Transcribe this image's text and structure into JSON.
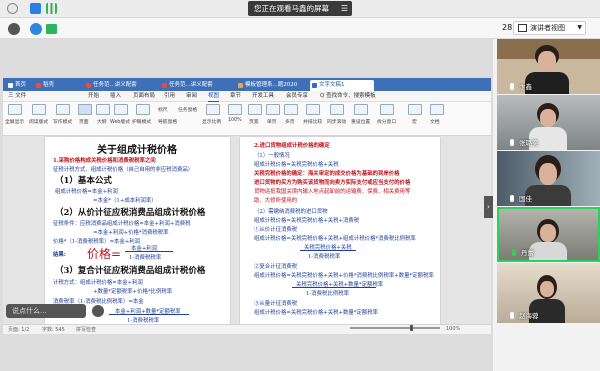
{
  "top_bar": {
    "banner": "您正在观看马鑫的屏幕"
  },
  "meeting_bar": {
    "timer": "28:11",
    "presenter_view": "演讲者视图"
  },
  "wps": {
    "tabs": [
      {
        "label": "首页"
      },
      {
        "label": "稻壳"
      },
      {
        "label": "任务范...讲义配套"
      },
      {
        "label": "任务范...讲义配套"
      },
      {
        "label": "模板管理系...题2020"
      },
      {
        "label": "文字文稿1"
      }
    ],
    "menus": [
      "三 文件",
      "开始",
      "插入",
      "页面布局",
      "引用",
      "审阅",
      "视图",
      "章节",
      "开发工具",
      "会员专享",
      "Q 查找命令、搜索模板"
    ],
    "ribbon": [
      "全屏显示",
      "阅读版式",
      "写作模式",
      "页面",
      "大纲",
      "Web版式",
      "护眼模式",
      "标尺",
      "任务窗格",
      "导航窗格",
      "显示比例",
      "100%",
      "页宽",
      "单页",
      "多页",
      "并排比较",
      "同步滚动",
      "重设位置",
      "拆分窗口",
      "宏",
      "文档"
    ],
    "status": {
      "page": "页面: 1/2",
      "words": "字数: 545",
      "check": "拼写检查",
      "zoom": "100%"
    }
  },
  "doc_left": {
    "title": "关于组成计税价格",
    "line1": "1.采购价格构成关税价格和消费税税率之间",
    "line2": "征税计税方式、组成计税价格（自己自用的非应税消费品）",
    "sec1": "（1）基本公式",
    "f1": "组成计税价格=本金+利润",
    "f2": "=本金*（1+成本利润率）",
    "sec2": "（2）从价计征应税消费品组成计税价格",
    "note2": "征税条件：应税消费品组成计税价格=本金+利润+消费税",
    "f3": "=本金+利润+价格*消费税税率",
    "f4": "价格*（1-消费税税率）=本金+利润",
    "calc": "结果:",
    "price_big": "价格=",
    "num": "本金+利润",
    "den": "1-消费税税率",
    "sec3": "（3）复合计征应税消费品组成计税价格",
    "note3": "计税方式：组成计税价格=本金+利润",
    "f5": "+数量*定额税率+价格*比例税率",
    "f6": "消费税率（1-消费税比例税率）=本金",
    "num2": "本金+利润+数量*定额税率",
    "den2": "1-消费税税率"
  },
  "doc_right": {
    "h1": "2.进口货物组成计税价格的确定",
    "sec1": "（1）一般情况",
    "l1": "组成计税价格=关税完税价格+关税",
    "l2": "关税完税价格的确定：海关审定的成交价格为基础的到岸价格",
    "l3": "进口货物的买方为购买该货物而向卖方实际支付或应当支付的价格",
    "l4": "货物运抵我国关境内输入地点起卸前的运输费、保费、相关费用等",
    "l5": "助、大修所使用的",
    "sec2": "（2）需缴纳消费税的进口货物",
    "l6": "组成计税价格=关税完税价格+关税+消费税",
    "sub1": "①从价计征消费税",
    "l7": "组成计税价格=关税完税价格+关税+组成计税价格*消费税比例税率",
    "frac1n": "关税完税价格+关税",
    "frac1d": "1-消费税税率",
    "sub2": "②复合计征消费税",
    "l8": "组成计税价格=关税完税价格+关税+价格*消费税比例税率+数量*定额税率",
    "frac2n": "关税完税价格+关税+数量*定额税率",
    "frac2d": "1-消费税比例税率",
    "sub3": "③从量计征消费税",
    "l9": "组成计税价格=关税完税价格+关税+数量*定额税率"
  },
  "chat": {
    "placeholder": "说点什么..."
  },
  "participants": [
    {
      "name": "卞鑫"
    },
    {
      "name": "张璐奕"
    },
    {
      "name": "国佳"
    },
    {
      "name": "丹蕾"
    },
    {
      "name": "赵海蓉"
    }
  ]
}
